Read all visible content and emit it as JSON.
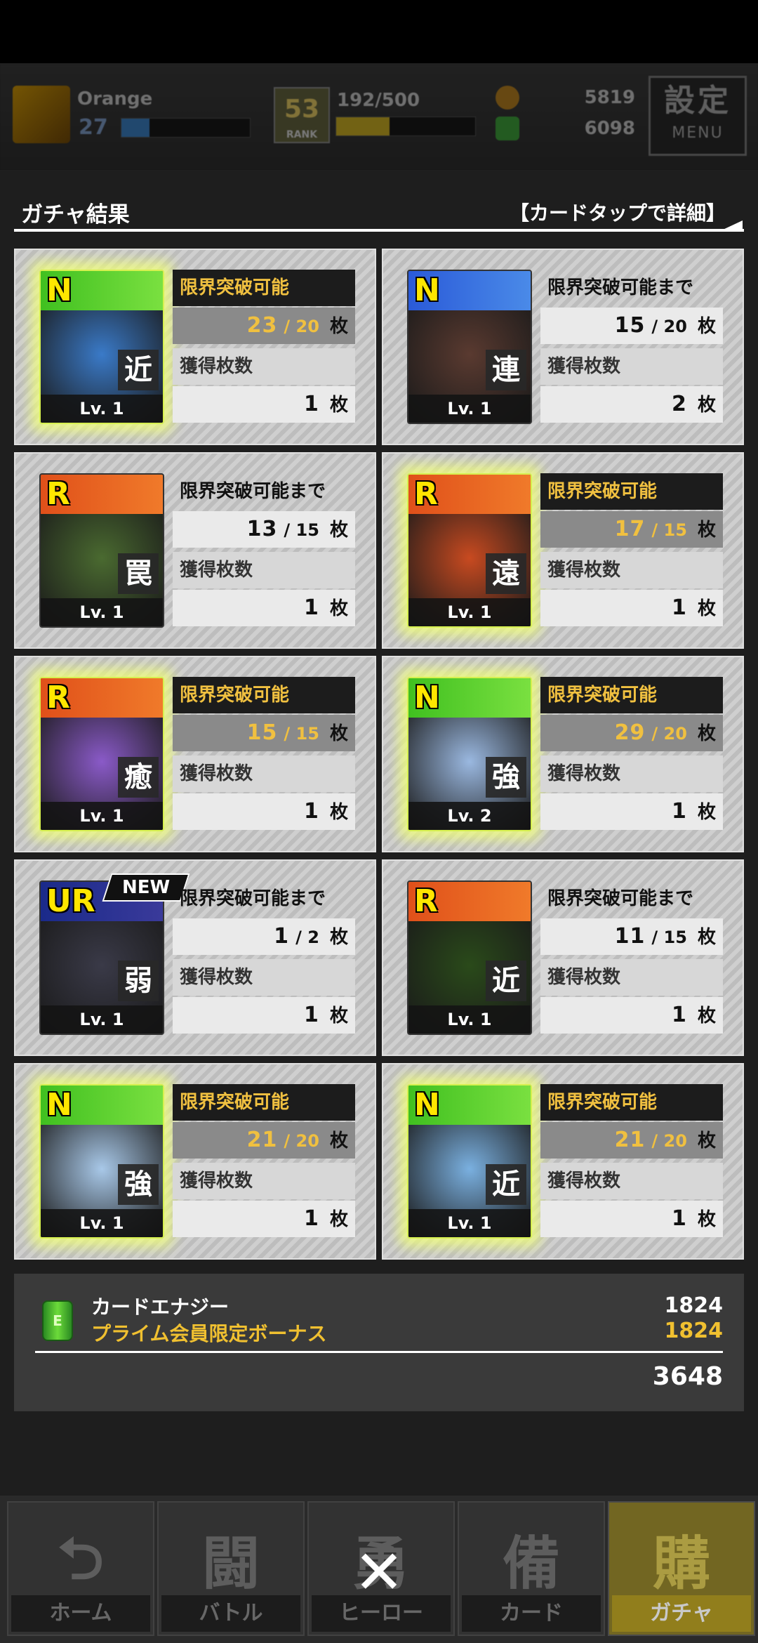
{
  "hud": {
    "player_name": "Orange",
    "player_level": "27",
    "rank_number": "53",
    "rank_label": "RANK",
    "exp": "192/500",
    "currency1": "5819",
    "currency2": "6098",
    "menu_kanji": "設定",
    "menu_label": "MENU",
    "lv_progress": 0.22,
    "exp_progress": 0.384
  },
  "header": {
    "title": "ガチャ結果",
    "hint": "【カードタップで詳細】"
  },
  "cards": [
    {
      "rarity": "N",
      "kanji": "近",
      "level": "Lv. 1",
      "status": "限界突破可能",
      "breakable": true,
      "have": "23",
      "need": "20",
      "unit": "枚",
      "obtained_label": "獲得枚数",
      "obtained": "1",
      "new": false,
      "bg": "#3a7ac8"
    },
    {
      "rarity": "N",
      "kanji": "連",
      "level": "Lv. 1",
      "status": "限界突破可能まで",
      "breakable": false,
      "have": "15",
      "need": "20",
      "unit": "枚",
      "obtained_label": "獲得枚数",
      "obtained": "2",
      "new": false,
      "bg": "#5a3a30"
    },
    {
      "rarity": "R",
      "kanji": "罠",
      "level": "Lv. 1",
      "status": "限界突破可能まで",
      "breakable": false,
      "have": "13",
      "need": "15",
      "unit": "枚",
      "obtained_label": "獲得枚数",
      "obtained": "1",
      "new": false,
      "bg": "#4a6a30"
    },
    {
      "rarity": "R",
      "kanji": "遠",
      "level": "Lv. 1",
      "status": "限界突破可能",
      "breakable": true,
      "have": "17",
      "need": "15",
      "unit": "枚",
      "obtained_label": "獲得枚数",
      "obtained": "1",
      "new": false,
      "bg": "#c84a20"
    },
    {
      "rarity": "R",
      "kanji": "癒",
      "level": "Lv. 1",
      "status": "限界突破可能",
      "breakable": true,
      "have": "15",
      "need": "15",
      "unit": "枚",
      "obtained_label": "獲得枚数",
      "obtained": "1",
      "new": false,
      "bg": "#8a5ac8"
    },
    {
      "rarity": "N",
      "kanji": "強",
      "level": "Lv. 2",
      "status": "限界突破可能",
      "breakable": true,
      "have": "29",
      "need": "20",
      "unit": "枚",
      "obtained_label": "獲得枚数",
      "obtained": "1",
      "new": false,
      "bg": "#9ab8e0"
    },
    {
      "rarity": "UR",
      "kanji": "弱",
      "level": "Lv. 1",
      "status": "限界突破可能まで",
      "breakable": false,
      "have": "1",
      "need": "2",
      "unit": "枚",
      "obtained_label": "獲得枚数",
      "obtained": "1",
      "new": true,
      "new_label": "NEW",
      "bg": "#3a3a48"
    },
    {
      "rarity": "R",
      "kanji": "近",
      "level": "Lv. 1",
      "status": "限界突破可能まで",
      "breakable": false,
      "have": "11",
      "need": "15",
      "unit": "枚",
      "obtained_label": "獲得枚数",
      "obtained": "1",
      "new": false,
      "bg": "#2a4a1a"
    },
    {
      "rarity": "N",
      "kanji": "強",
      "level": "Lv. 1",
      "status": "限界突破可能",
      "breakable": true,
      "have": "21",
      "need": "20",
      "unit": "枚",
      "obtained_label": "獲得枚数",
      "obtained": "1",
      "new": false,
      "bg": "#a8c8e8"
    },
    {
      "rarity": "N",
      "kanji": "近",
      "level": "Lv. 1",
      "status": "限界突破可能",
      "breakable": true,
      "have": "21",
      "need": "20",
      "unit": "枚",
      "obtained_label": "獲得枚数",
      "obtained": "1",
      "new": false,
      "bg": "#7ab0e0"
    }
  ],
  "energy": {
    "icon_text": "E",
    "label": "カードエナジー",
    "bonus_label": "プライム会員限定ボーナス",
    "value": "1824",
    "bonus_value": "1824",
    "total": "3648"
  },
  "nav": [
    {
      "label": "ホーム",
      "icon": "home-icon",
      "glyph": "⮌",
      "active": false
    },
    {
      "label": "バトル",
      "icon": "gamepad-icon",
      "glyph": "闘",
      "active": false
    },
    {
      "label": "ヒーロー",
      "icon": "hero-icon",
      "glyph": "勇",
      "active": false
    },
    {
      "label": "カード",
      "icon": "card-icon",
      "glyph": "備",
      "active": false
    },
    {
      "label": "ガチャ",
      "icon": "gacha-icon",
      "glyph": "購",
      "active": true
    }
  ],
  "close_glyph": "✕",
  "colors": {
    "accent": "#f0c040",
    "glow": "#e8ff6a",
    "active_tab": "#b49a18"
  }
}
